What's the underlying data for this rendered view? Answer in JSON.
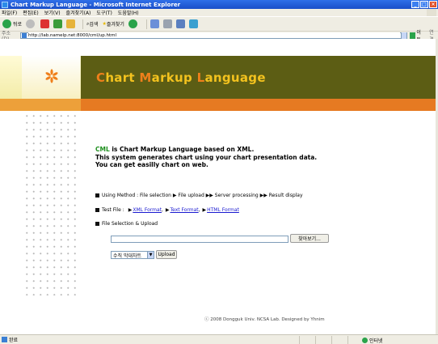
{
  "window": {
    "title": "Chart Markup Language - Microsoft Internet Explorer"
  },
  "menu": [
    "파일(F)",
    "편집(E)",
    "보기(V)",
    "즐겨찾기(A)",
    "도구(T)",
    "도움말(H)"
  ],
  "toolbar": {
    "back_label": "뒤로",
    "search_label": "검색",
    "favorites_label": "즐겨찾기"
  },
  "address": {
    "label": "주소(D)",
    "url": "http://lab.namelp.net:8000/cml/up.html",
    "go_label": "이동",
    "links_label": "연결"
  },
  "page": {
    "title_parts": [
      "C",
      "hart ",
      "M",
      "arkup ",
      "L",
      "anguage"
    ],
    "intro_cml": "CML",
    "intro_line1_rest": " is Chart Markup Language based on XML.",
    "intro_line2": "This system generates chart using your chart presentation data.",
    "intro_line3": "You can get easilly chart on web.",
    "using_method": "Using Method : File selection ▶ File upload ▶▶ Server processing ▶▶ Result display",
    "test_file_label": "Test File :",
    "test_links": [
      "XML Format",
      "Text Format",
      "HTML Format"
    ],
    "file_section_label": "File Selection & Upload",
    "browse_label": "찾아보기...",
    "chart_type_value": "수직 막대차트",
    "upload_label": "Upload",
    "footer": "ⓒ 2008 Dongguk Univ. NCSA Lab. Designed by Yhnim"
  },
  "status": {
    "text": "완료",
    "zone": "인터넷"
  },
  "colors": {
    "header_olive": "#5c5d14",
    "title_yellow": "#f3c21e",
    "title_orange": "#ef7f1b",
    "orange_bar": "#e67a22",
    "cml_green": "#1e8f1e"
  }
}
